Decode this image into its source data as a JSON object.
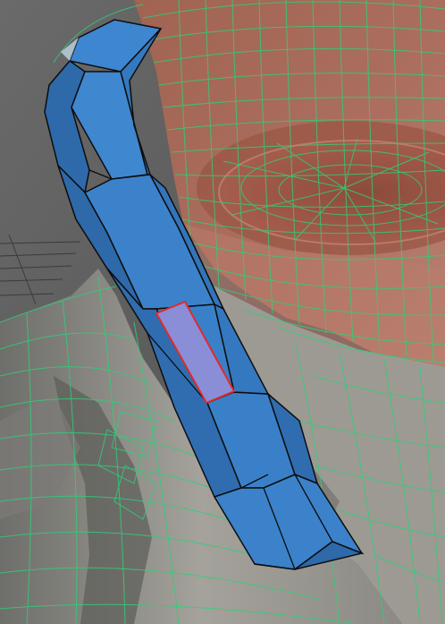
{
  "viewport": {
    "background_color": "#5f5f5f",
    "wireframe_color": "#2fcf78",
    "selected_mesh_color": "#3a7fc6",
    "selected_edge_color": "#0d0d0d",
    "active_face_color": "#8a8ed6",
    "active_face_outline_color": "#e02a2a",
    "skin_color": "#b36b5a",
    "neck_color": "#8e8e88"
  }
}
